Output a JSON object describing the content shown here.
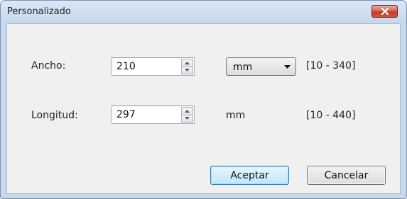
{
  "window": {
    "title": "Personalizado"
  },
  "form": {
    "width_label": "Ancho:",
    "width_value": "210",
    "unit_selected": "mm",
    "width_range": "[10 - 340]",
    "length_label": "Longitud:",
    "length_value": "297",
    "length_unit": "mm",
    "length_range": "[10 - 440]"
  },
  "buttons": {
    "accept_label": "Aceptar",
    "cancel_label": "Cancelar"
  },
  "icons": {
    "close": "close-icon",
    "spin_up": "spin-up-icon",
    "spin_down": "spin-down-icon",
    "dropdown": "chevron-down-icon"
  }
}
